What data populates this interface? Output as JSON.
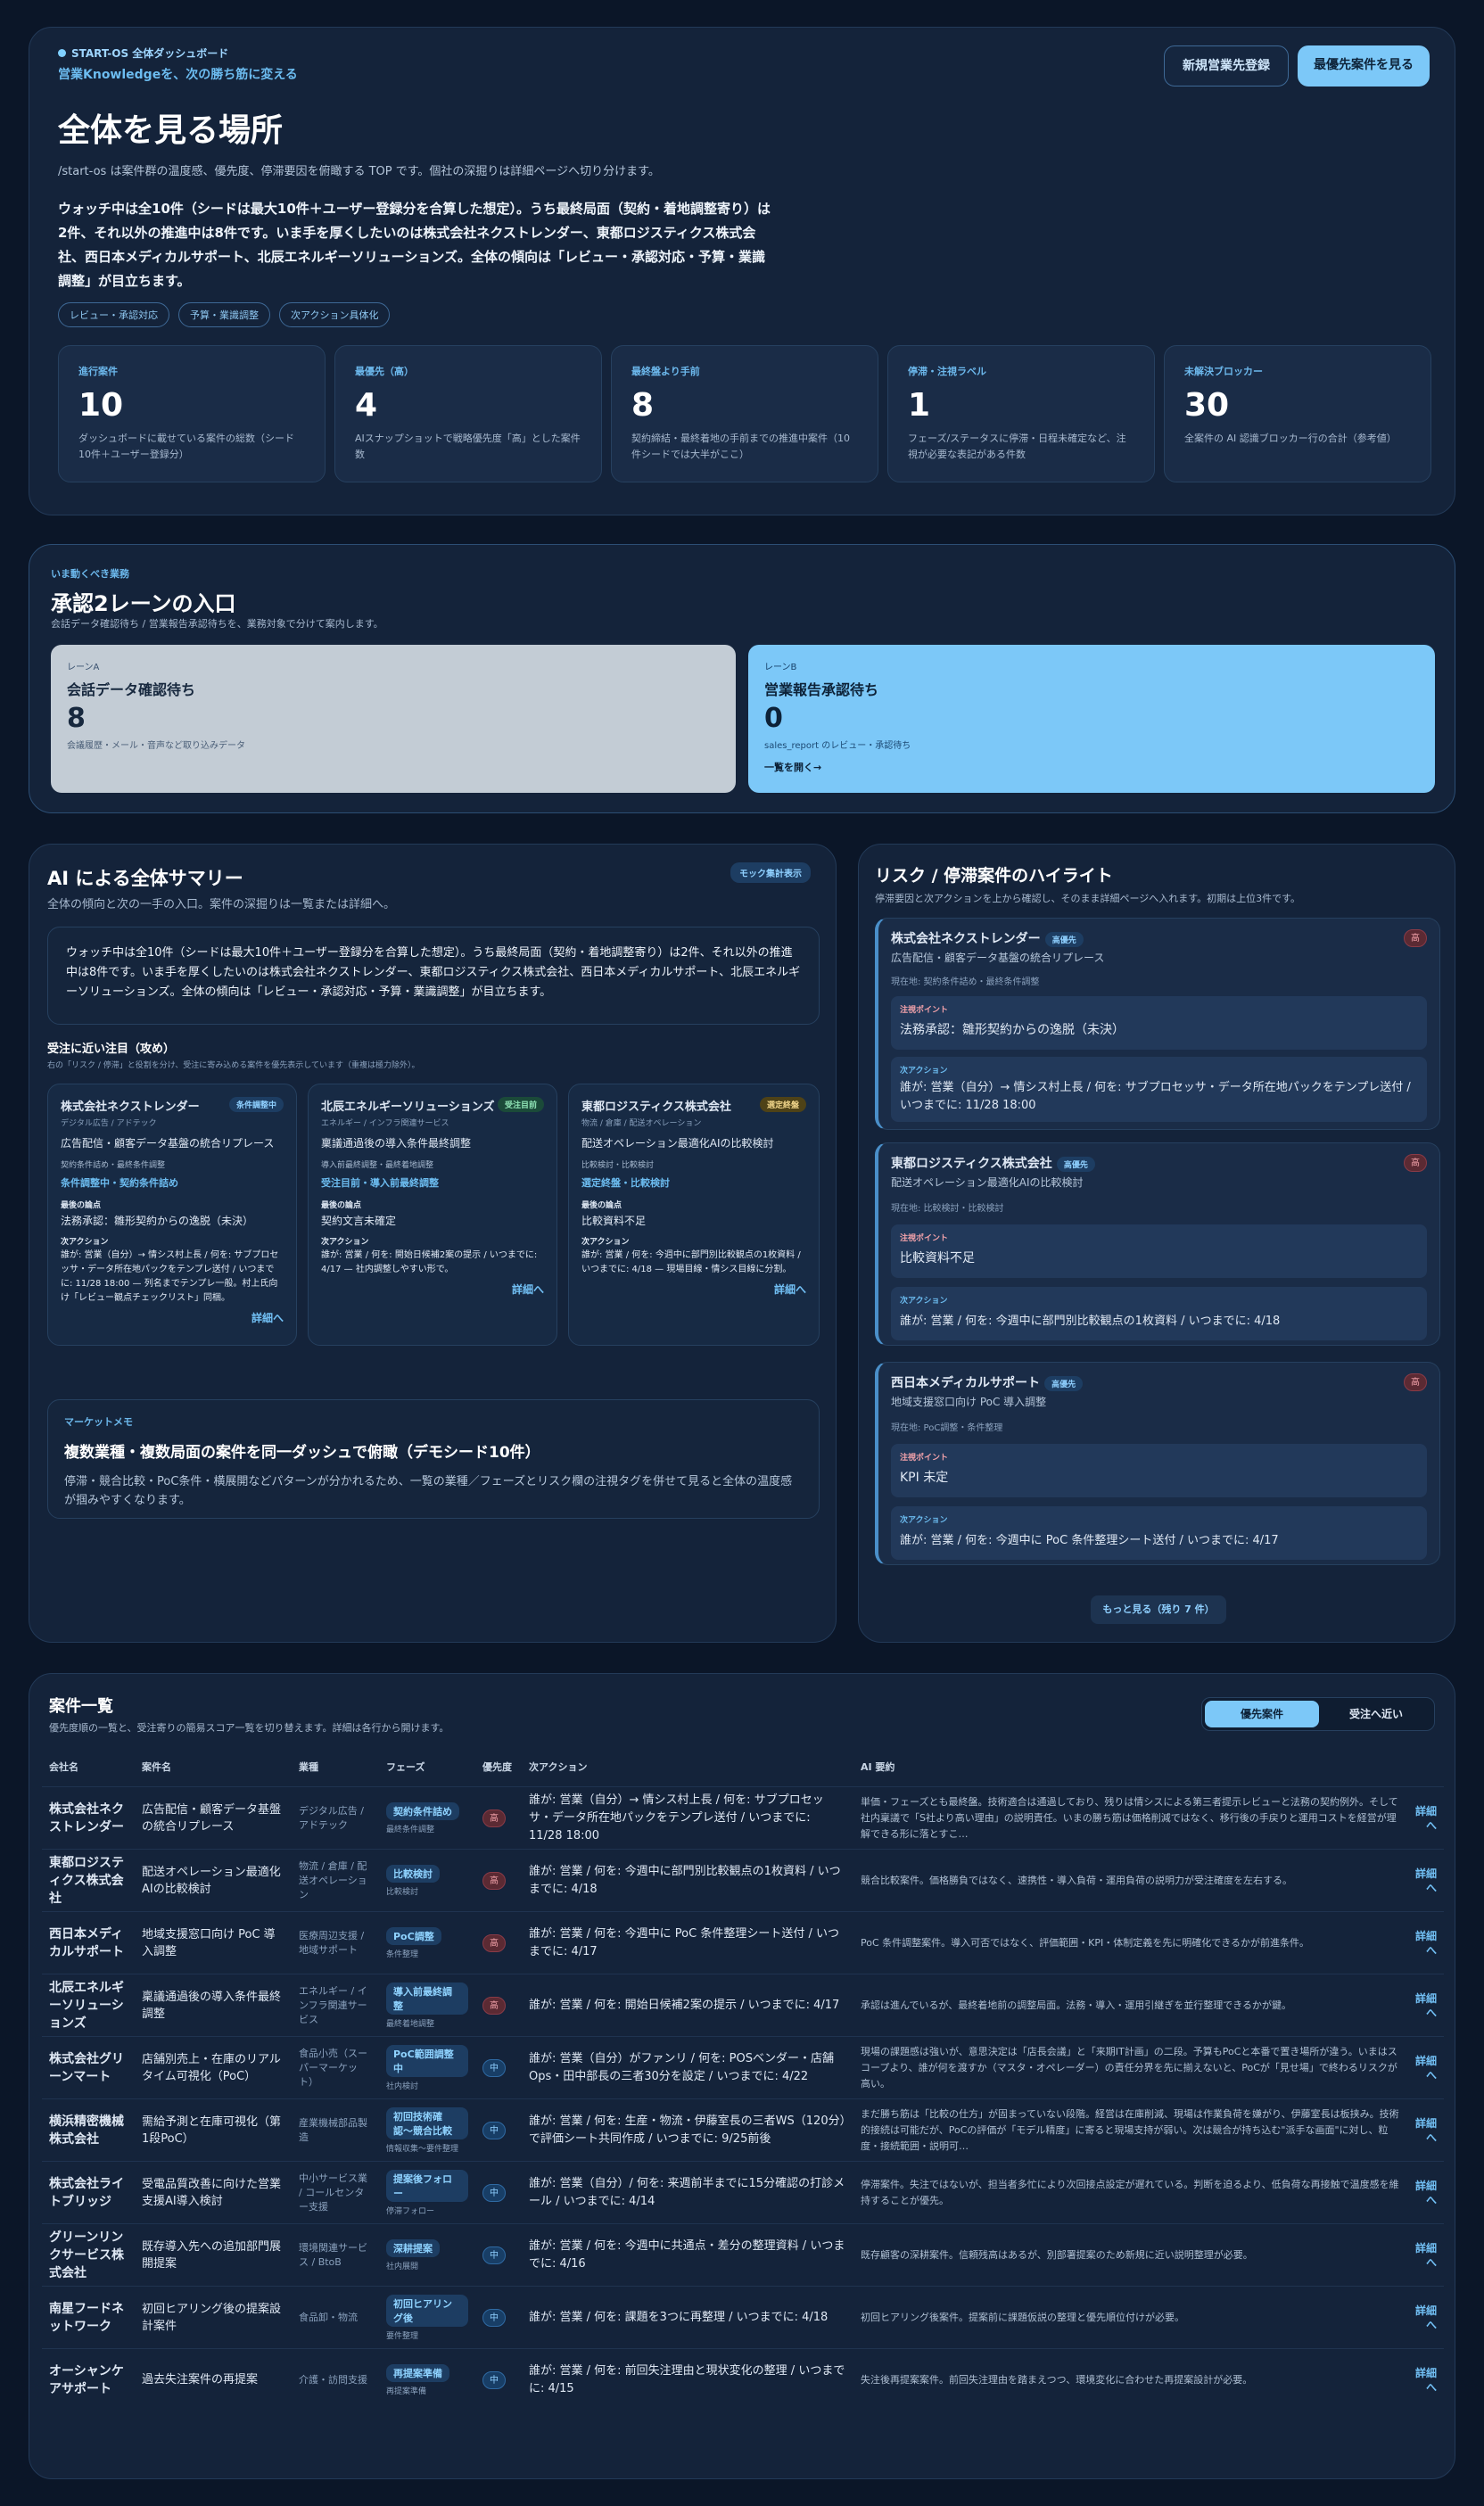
{
  "hero": {
    "eyebrow": "START-OS 全体ダッシュボード",
    "subtitle": "営業Knowledgeを、次の勝ち筋に変える",
    "title": "全体を見る場所",
    "desc": "/start-os は案件群の温度感、優先度、停滞要因を俯瞰する TOP です。個社の深掘りは詳細ページへ切り分けます。",
    "summary": "ウォッチ中は全10件（シードは最大10件＋ユーザー登録分を合算した想定）。うち最終局面（契約・着地調整寄り）は2件、それ以外の推進中は8件です。いま手を厚くしたいのは株式会社ネクストレンダー、東都ロジスティクス株式会社、西日本メディカルサポート、北辰エネルギーソリューションズ。全体の傾向は「レビュー・承認対応・予算・業識調整」が目立ちます。",
    "tags": [
      "レビュー・承認対応",
      "予算・業識調整",
      "次アクション具体化"
    ],
    "btn_new": "新規営業先登録",
    "btn_top": "最優先案件を見る"
  },
  "kpis": [
    {
      "label": "進行案件",
      "value": "10",
      "desc": "ダッシュボードに載せている案件の総数（シード10件＋ユーザー登録分）"
    },
    {
      "label": "最優先（高）",
      "value": "4",
      "desc": "AIスナップショットで戦略優先度「高」とした案件数"
    },
    {
      "label": "最終盤より手前",
      "value": "8",
      "desc": "契約締結・最終着地の手前までの推進中案件（10件シードでは大半がここ）"
    },
    {
      "label": "停滞・注視ラベル",
      "value": "1",
      "desc": "フェーズ/ステータスに停滞・日程未確定など、注視が必要な表記がある件数"
    },
    {
      "label": "未解決ブロッカー",
      "value": "30",
      "desc": "全案件の AI 認識ブロッカー行の合計（参考値）"
    }
  ],
  "approval": {
    "eyebrow": "いま動くべき業務",
    "title": "承認2レーンの入口",
    "desc": "会話データ確認待ち / 営業報告承認待ちを、業務対象で分けて案内します。",
    "laneA": {
      "tag": "レーンA",
      "title": "会話データ確認待ち",
      "value": "8",
      "desc": "会議履歴・メール・音声など取り込みデータ"
    },
    "laneB": {
      "tag": "レーンB",
      "title": "営業報告承認待ち",
      "value": "0",
      "desc": "sales_report のレビュー・承認待ち",
      "link": "一覧を開く→"
    }
  },
  "summary": {
    "title": "AI による全体サマリー",
    "badge": "モック集計表示",
    "desc": "全体の傾向と次の一手の入口。案件の深掘りは一覧または詳細へ。",
    "box": "ウォッチ中は全10件（シードは最大10件＋ユーザー登録分を合算した想定）。うち最終局面（契約・着地調整寄り）は2件、それ以外の推進中は8件です。いま手を厚くしたいのは株式会社ネクストレンダー、東都ロジスティクス株式会社、西日本メディカルサポート、北辰エネルギーソリューションズ。全体の傾向は「レビュー・承認対応・予算・業識調整」が目立ちます。",
    "near_title": "受注に近い注目（攻め）",
    "near_desc": "右の「リスク / 停滞」と役割を分け、受注に寄み込める案件を優先表示しています（重複は極力除外）。",
    "near": [
      {
        "name": "株式会社ネクストレンダー",
        "tag": "条件調整中",
        "ind": "デジタル広告 / アドテック",
        "case": "広告配信・顧客データ基盤の統合リプレース",
        "phase1": "契約条件詰め・最終条件調整",
        "phase2": "条件調整中・契約条件詰め",
        "bl": "最後の論点",
        "issue": "法務承認：雛形契約からの逸脱（未決）",
        "nl": "次アクション",
        "next": "誰が: 営業（自分）→ 情シス村上長 / 何を: サブプロセッサ・データ所在地パックをテンプレ送付 / いつまでに: 11/28 18:00 — 列名までテンプレ一般。村上氏向け「レビュー観点チェックリスト」同梱。",
        "link": "詳細へ"
      },
      {
        "name": "北辰エネルギーソリューションズ",
        "tag": "受注目前",
        "ind": "エネルギー / インフラ関連サービス",
        "case": "稟議通過後の導入条件最終調整",
        "phase1": "導入前最終調整・最終着地調整",
        "phase2": "受注目前・導入前最終調整",
        "bl": "最後の論点",
        "issue": "契約文言未確定",
        "nl": "次アクション",
        "next": "誰が: 営業 / 何を: 開始日候補2案の提示 / いつまでに: 4/17 — 社内調整しやすい形で。",
        "link": "詳細へ"
      },
      {
        "name": "東都ロジスティクス株式会社",
        "tag": "選定終盤",
        "ind": "物流 / 倉庫 / 配送オペレーション",
        "case": "配送オペレーション最適化AIの比較検討",
        "phase1": "比較検討・比較検討",
        "phase2": "選定終盤・比較検討",
        "bl": "最後の論点",
        "issue": "比較資料不足",
        "nl": "次アクション",
        "next": "誰が: 営業 / 何を: 今週中に部門別比較観点の1枚資料 / いつまでに: 4/18 — 現場目線・情シス目線に分割。",
        "link": "詳細へ"
      }
    ],
    "memo_label": "マーケットメモ",
    "memo_title": "複数業種・複数局面の案件を同一ダッシュで俯瞰（デモシード10件）",
    "memo_desc": "停滞・競合比較・PoC条件・横展開などパターンが分かれるため、一覧の業種／フェーズとリスク欄の注視タグを併せて見ると全体の温度感が掴みやすくなります。"
  },
  "risk": {
    "title": "リスク / 停滞案件のハイライト",
    "desc": "停滞要因と次アクションを上から確認し、そのまま詳細ページへ入れます。初期は上位3件です。",
    "items": [
      {
        "name": "株式会社ネクストレンダー",
        "tag": "高優先",
        "pri": "高",
        "case": "広告配信・顧客データ基盤の統合リプレース",
        "now": "現在地: 契約条件詰め・最終条件調整",
        "pl": "注視ポイント",
        "point": "法務承認：雛形契約からの逸脱（未決）",
        "nl": "次アクション",
        "next": "誰が: 営業（自分）→ 情シス村上長 / 何を: サブプロセッサ・データ所在地パックをテンプレ送付 / いつまでに: 11/28 18:00"
      },
      {
        "name": "東都ロジスティクス株式会社",
        "tag": "高優先",
        "pri": "高",
        "case": "配送オペレーション最適化AIの比較検討",
        "now": "現在地: 比較検討・比較検討",
        "pl": "注視ポイント",
        "point": "比較資料不足",
        "nl": "次アクション",
        "next": "誰が: 営業 / 何を: 今週中に部門別比較観点の1枚資料 / いつまでに: 4/18"
      },
      {
        "name": "西日本メディカルサポート",
        "tag": "高優先",
        "pri": "高",
        "case": "地域支援窓口向け PoC 導入調整",
        "now": "現在地: PoC調整・条件整理",
        "pl": "注視ポイント",
        "point": "KPI 未定",
        "nl": "次アクション",
        "next": "誰が: 営業 / 何を: 今週中に PoC 条件整理シート送付 / いつまでに: 4/17"
      }
    ],
    "more": "もっと見る（残り 7 件）"
  },
  "list": {
    "title": "案件一覧",
    "desc": "優先度順の一覧と、受注寄りの簡易スコア一覧を切り替えます。詳細は各行から開けます。",
    "tab1": "優先案件",
    "tab2": "受注へ近い",
    "headers": [
      "会社名",
      "案件名",
      "業種",
      "フェーズ",
      "優先度",
      "次アクション",
      "AI 要約",
      ""
    ],
    "rows": [
      {
        "company": "株式会社ネクストレンダー",
        "case": "広告配信・顧客データ基盤の統合リプレース",
        "ind": "デジタル広告 / アドテック",
        "phase": "契約条件詰め",
        "sub": "最終条件調整",
        "pri": "高",
        "next": "誰が: 営業（自分）→ 情シス村上長 / 何を: サブプロセッサ・データ所在地パックをテンプレ送付 / いつまでに: 11/28 18:00",
        "ai": "単価・フェーズとも最終盤。技術適合は通過しており、残りは情シスによる第三者提示レビューと法務の契約例外。そして社内稟議で「S社より高い理由」の説明責任。いまの勝ち筋は価格削減ではなく、移行後の手戻りと運用コストを経営が理解できる形に落とすこ…",
        "link": "詳細へ"
      },
      {
        "company": "東都ロジスティクス株式会社",
        "case": "配送オペレーション最適化AIの比較検討",
        "ind": "物流 / 倉庫 / 配送オペレーション",
        "phase": "比較検討",
        "sub": "比較検討",
        "pri": "高",
        "next": "誰が: 営業 / 何を: 今週中に部門別比較観点の1枚資料 / いつまでに: 4/18",
        "ai": "競合比較案件。価格勝負ではなく、速携性・導入負荷・運用負荷の説明力が受注確度を左右する。",
        "link": "詳細へ"
      },
      {
        "company": "西日本メディカルサポート",
        "case": "地域支援窓口向け PoC 導入調整",
        "ind": "医療周辺支援 / 地域サポート",
        "phase": "PoC調整",
        "sub": "条件整理",
        "pri": "高",
        "next": "誰が: 営業 / 何を: 今週中に PoC 条件整理シート送付 / いつまでに: 4/17",
        "ai": "PoC 条件調整案件。導入可否ではなく、評価範囲・KPI・体制定義を先に明確化できるかが前進条件。",
        "link": "詳細へ"
      },
      {
        "company": "北辰エネルギーソリューションズ",
        "case": "稟議通過後の導入条件最終調整",
        "ind": "エネルギー / インフラ関連サービス",
        "phase": "導入前最終調整",
        "sub": "最終着地調整",
        "pri": "高",
        "next": "誰が: 営業 / 何を: 開始日候補2案の提示 / いつまでに: 4/17",
        "ai": "承認は進んでいるが、最終着地前の調整局面。法務・導入・運用引継ぎを並行整理できるかが鍵。",
        "link": "詳細へ"
      },
      {
        "company": "株式会社グリーンマート",
        "case": "店舗別売上・在庫のリアルタイム可視化（PoC）",
        "ind": "食品小売（スーパーマーケット）",
        "phase": "PoC範囲調整中",
        "sub": "社内検討",
        "pri": "中",
        "next": "誰が: 営業（自分）がファンリ / 何を: POSベンダー・店舗Ops・田中部長の三者30分を設定 / いつまでに: 4/22",
        "ai": "現場の課題感は強いが、意思決定は「店長会議」と「来期IT計画」の二段。予算もPoCと本番で置き場所が違う。いまはスコープより、誰が何を渡すか（マスタ・オペレーダー）の責任分界を先に揃えないと、PoCが「見せ場」で終わるリスクが高い。",
        "link": "詳細へ"
      },
      {
        "company": "横浜精密機械株式会社",
        "case": "需給予測と在庫可視化（第1段PoC）",
        "ind": "産業機械部品製造",
        "phase": "初回技術確認〜競合比較",
        "sub": "情報収集〜要件整理",
        "pri": "中",
        "next": "誰が: 営業 / 何を: 生産・物流・伊藤室長の三者WS（120分）で評価シート共同作成 / いつまでに: 9/25前後",
        "ai": "まだ勝ち筋は「比較の仕方」が固まっていない段階。経営は在庫削減、現場は作業負荷を嫌がり、伊藤室長は板挟み。技術的接続は可能だが、PoCの評価が「モデル精度」に寄ると現場支持が弱い。次は競合が持ち込む\"派手な画面\"に対し、粒度・接続範囲・説明可…",
        "link": "詳細へ"
      },
      {
        "company": "株式会社ライトブリッジ",
        "case": "受電品質改善に向けた営業支援AI導入検討",
        "ind": "中小サービス業 / コールセンター支援",
        "phase": "提案後フォロー",
        "sub": "停滞フォロー",
        "pri": "中",
        "next": "誰が: 営業（自分）/ 何を: 来週前半までに15分確認の打診メール / いつまでに: 4/14",
        "ai": "停滞案件。失注ではないが、担当者多忙により次回接点設定が遅れている。判断を迫るより、低負荷な再接触で温度感を維持することが優先。",
        "link": "詳細へ"
      },
      {
        "company": "グリーンリンクサービス株式会社",
        "case": "既存導入先への追加部門展開提案",
        "ind": "環境関連サービス / BtoB",
        "phase": "深耕提案",
        "sub": "社内展開",
        "pri": "中",
        "next": "誰が: 営業 / 何を: 今週中に共通点・差分の整理資料 / いつまでに: 4/16",
        "ai": "既存顧客の深耕案件。信頼残高はあるが、別部署提案のため新規に近い説明整理が必要。",
        "link": "詳細へ"
      },
      {
        "company": "南星フードネットワーク",
        "case": "初回ヒアリング後の提案設計案件",
        "ind": "食品卸・物流",
        "phase": "初回ヒアリング後",
        "sub": "要件整理",
        "pri": "中",
        "next": "誰が: 営業 / 何を: 課題を3つに再整理 / いつまでに: 4/18",
        "ai": "初回ヒアリング後案件。提案前に課題仮説の整理と優先順位付けが必要。",
        "link": "詳細へ"
      },
      {
        "company": "オーシャンケアサポート",
        "case": "過去失注案件の再提案",
        "ind": "介護・訪問支援",
        "phase": "再提案準備",
        "sub": "再提案準備",
        "pri": "中",
        "next": "誰が: 営業 / 何を: 前回失注理由と現状変化の整理 / いつまでに: 4/15",
        "ai": "失注後再提案案件。前回失注理由を踏まえつつ、環境変化に合わせた再提案設計が必要。",
        "link": "詳細へ"
      }
    ]
  }
}
